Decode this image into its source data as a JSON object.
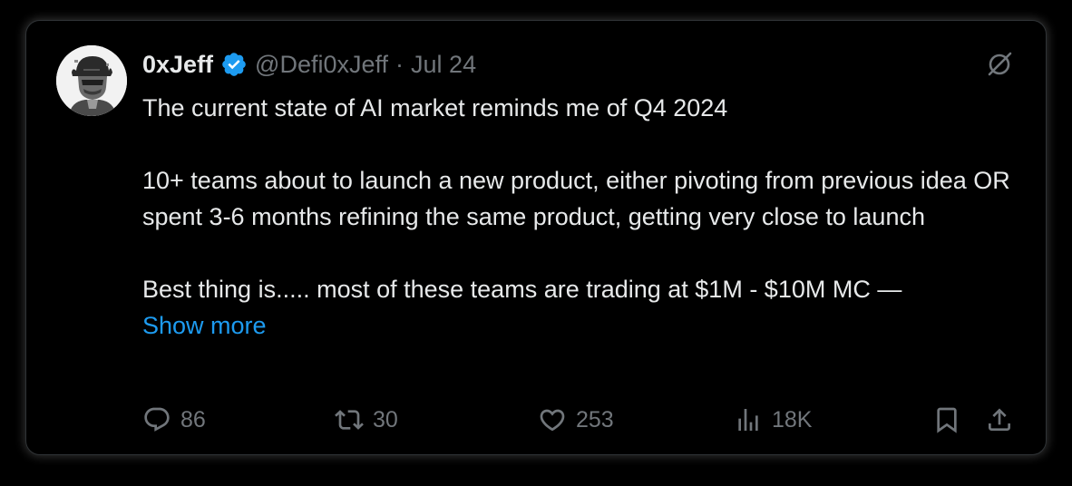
{
  "author": {
    "name": "0xJeff",
    "handle": "@Defi0xJeff",
    "separator": "·",
    "date": "Jul 24"
  },
  "tweet": {
    "paragraphs": [
      "The current state of AI market reminds me of Q4 2024",
      "10+ teams about to launch a new product, either pivoting from previous idea OR spent 3-6 months refining the same product, getting very close to launch",
      "Best thing is..... most of these teams are trading at $1M - $10M MC —"
    ],
    "show_more": "Show more"
  },
  "actions": {
    "replies": "86",
    "reposts": "30",
    "likes": "253",
    "views": "18K"
  },
  "colors": {
    "background": "#000000",
    "text": "#e7e9ea",
    "muted": "#71767b",
    "accent": "#1d9bf0",
    "border": "#2f3336"
  },
  "icons": [
    "verified-badge-icon",
    "grok-icon",
    "reply-icon",
    "repost-icon",
    "like-icon",
    "views-icon",
    "bookmark-icon",
    "share-icon"
  ]
}
